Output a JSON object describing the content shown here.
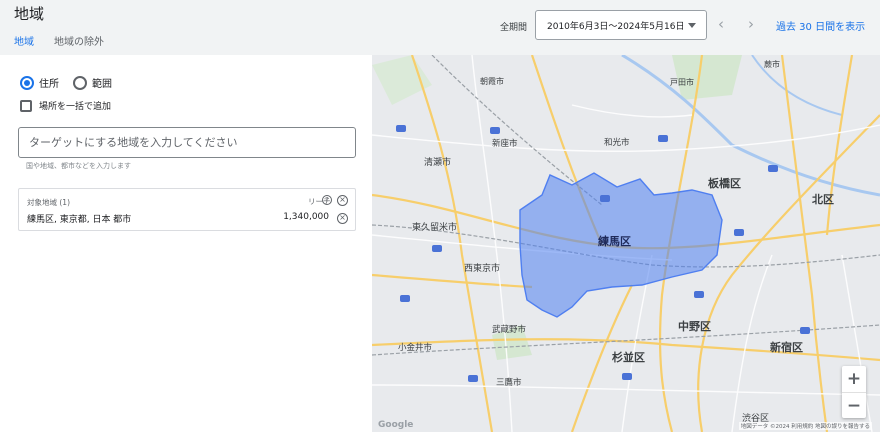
{
  "header": {
    "title": "地域",
    "tabs": [
      {
        "label": "地域",
        "active": true
      },
      {
        "label": "地域の除外",
        "active": false
      }
    ]
  },
  "date_filter": {
    "label": "全期間",
    "value": "2010年6月3日～2024年5月16日",
    "link": "過去 30 日間を表示"
  },
  "panel": {
    "radio_address": "住所",
    "radio_radius": "範囲",
    "bulk_label": "場所を一括で追加",
    "input_placeholder": "ターゲットにする地域を入力してください",
    "input_hint": "国や地域、都市などを入力します",
    "targets_header": "対象地域 (1)",
    "reach_label": "リーチ",
    "target_name": "練馬区, 東京都, 日本 都市",
    "target_reach": "1,340,000"
  },
  "map": {
    "highlight_color": "#4f7ff0",
    "labels": {
      "itabashi": "板橋区",
      "nerima": "練馬区",
      "kita": "北区",
      "nakano": "中野区",
      "suginami": "杉並区",
      "shinjuku": "新宿区",
      "kiyose": "清瀬市",
      "higashikurume": "東久留米市",
      "nishitokyo": "西東京市",
      "musashino": "武蔵野市",
      "koganei": "小金井市",
      "mitaka": "三鷹市",
      "niiza": "新座市",
      "wako": "和光市",
      "asaka": "朝霞市",
      "toda": "戸田市",
      "warabi": "蕨市",
      "shibuya": "渋谷区"
    },
    "attribution": "地図データ ©2024  利用規約  地図の誤りを報告する",
    "google": "Google"
  }
}
